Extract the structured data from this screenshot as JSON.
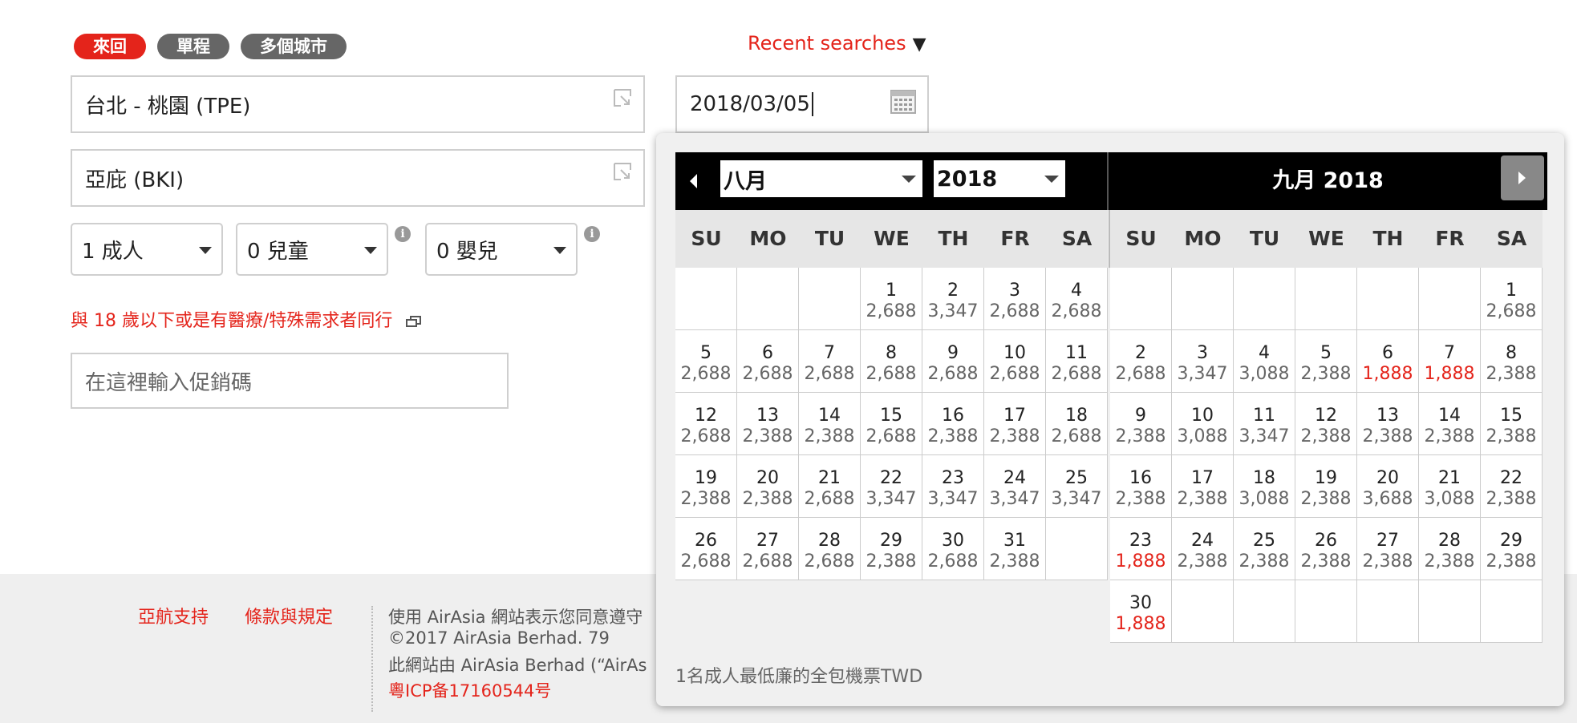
{
  "trip_types": [
    "來回",
    "單程",
    "多個城市"
  ],
  "recent_searches": "Recent searches",
  "origin": "台北 - 桃園 (TPE)",
  "destination": "亞庇 (BKI)",
  "date": "2018/03/05",
  "passengers": {
    "adults": "1 成人",
    "children": "0 兒童",
    "infants": "0 嬰兒"
  },
  "info_glyph": "i",
  "child_link": "與 18 歲以下或是有醫療/特殊需求者同行",
  "promo_placeholder": "在這裡輸入促銷碼",
  "footer": {
    "links": [
      "亞航支持",
      "條款與規定"
    ],
    "lines": [
      "使用 AirAsia 網站表示您同意遵守",
      "©2017 AirAsia Berhad. 79",
      "此網站由 AirAsia Berhad (“AirAs"
    ],
    "icp": "粵ICP备17160544号"
  },
  "calendar": {
    "month_select": "八月",
    "year_select": "2018",
    "second_title": "九月  2018",
    "weekdays": [
      "SU",
      "MO",
      "TU",
      "WE",
      "TH",
      "FR",
      "SA"
    ],
    "note": "1名成人最低廉的全包機票TWD",
    "months": [
      {
        "offset": 3,
        "days": [
          [
            "1",
            "2,688"
          ],
          [
            "2",
            "3,347"
          ],
          [
            "3",
            "2,688"
          ],
          [
            "4",
            "2,688"
          ],
          [
            "5",
            "2,688"
          ],
          [
            "6",
            "2,688"
          ],
          [
            "7",
            "2,688"
          ],
          [
            "8",
            "2,688"
          ],
          [
            "9",
            "2,688"
          ],
          [
            "10",
            "2,688"
          ],
          [
            "11",
            "2,688"
          ],
          [
            "12",
            "2,688"
          ],
          [
            "13",
            "2,388"
          ],
          [
            "14",
            "2,388"
          ],
          [
            "15",
            "2,688"
          ],
          [
            "16",
            "2,388"
          ],
          [
            "17",
            "2,388"
          ],
          [
            "18",
            "2,688"
          ],
          [
            "19",
            "2,388"
          ],
          [
            "20",
            "2,388"
          ],
          [
            "21",
            "2,688"
          ],
          [
            "22",
            "3,347"
          ],
          [
            "23",
            "3,347"
          ],
          [
            "24",
            "3,347"
          ],
          [
            "25",
            "3,347"
          ],
          [
            "26",
            "2,688"
          ],
          [
            "27",
            "2,688"
          ],
          [
            "28",
            "2,688"
          ],
          [
            "29",
            "2,388"
          ],
          [
            "30",
            "2,688"
          ],
          [
            "31",
            "2,388"
          ]
        ],
        "rows": 5
      },
      {
        "offset": 6,
        "days": [
          [
            "1",
            "2,688"
          ],
          [
            "2",
            "2,688"
          ],
          [
            "3",
            "3,347"
          ],
          [
            "4",
            "3,088"
          ],
          [
            "5",
            "2,388"
          ],
          [
            "6",
            "1,888"
          ],
          [
            "7",
            "1,888"
          ],
          [
            "8",
            "2,388"
          ],
          [
            "9",
            "2,388"
          ],
          [
            "10",
            "3,088"
          ],
          [
            "11",
            "3,347"
          ],
          [
            "12",
            "2,388"
          ],
          [
            "13",
            "2,388"
          ],
          [
            "14",
            "2,388"
          ],
          [
            "15",
            "2,388"
          ],
          [
            "16",
            "2,388"
          ],
          [
            "17",
            "2,388"
          ],
          [
            "18",
            "3,088"
          ],
          [
            "19",
            "2,388"
          ],
          [
            "20",
            "3,688"
          ],
          [
            "21",
            "3,088"
          ],
          [
            "22",
            "2,388"
          ],
          [
            "23",
            "1,888"
          ],
          [
            "24",
            "2,388"
          ],
          [
            "25",
            "2,388"
          ],
          [
            "26",
            "2,388"
          ],
          [
            "27",
            "2,388"
          ],
          [
            "28",
            "2,388"
          ],
          [
            "29",
            "2,388"
          ],
          [
            "30",
            "1,888"
          ]
        ],
        "rows": 6
      }
    ],
    "lowest_fare": "1,888",
    "accent_color": "#e4241b"
  }
}
